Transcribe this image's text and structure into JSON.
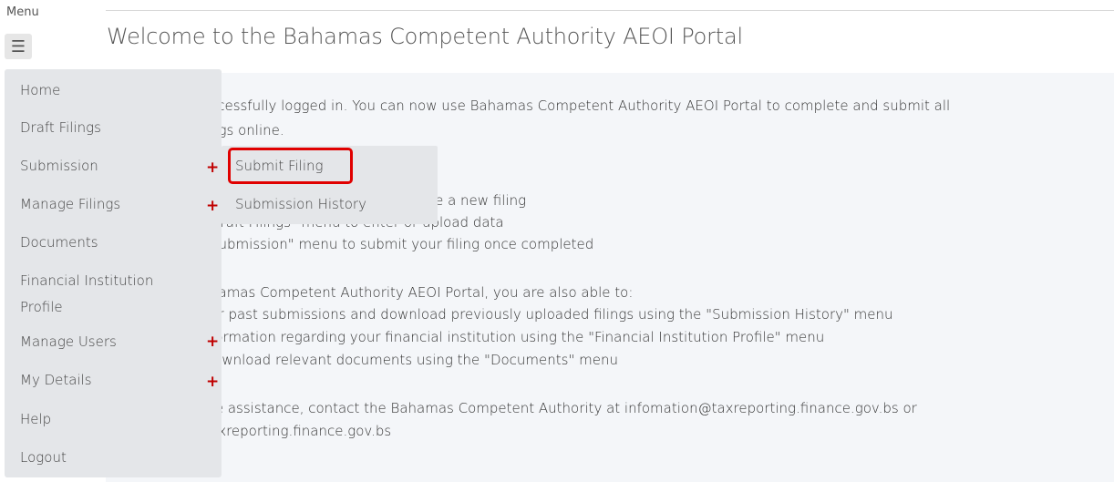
{
  "header": {
    "menu_label": "Menu",
    "title": "Welcome to the Bahamas Competent Authority AEOI Portal"
  },
  "menu": {
    "items": [
      {
        "label": "Home"
      },
      {
        "label": "Draft Filings"
      },
      {
        "label": "Submission",
        "has_submenu": true
      },
      {
        "label": "Manage Filings",
        "has_submenu": true
      },
      {
        "label": "Documents"
      },
      {
        "label": "Financial Institution",
        "label_line2": "Profile"
      },
      {
        "label": "Manage Users",
        "has_submenu": true
      },
      {
        "label": "My Details",
        "has_submenu": true
      },
      {
        "label": "Help"
      },
      {
        "label": "Logout"
      }
    ],
    "submission_submenu": [
      {
        "label": "Submit Filing",
        "highlighted": true
      },
      {
        "label": "Submission History"
      }
    ]
  },
  "content": {
    "lines": [
      "ccessfully logged in. You can now use Bahamas Competent Authority AEOI Portal to complete and submit all",
      "ngs online.",
      ":",
      "ate a new filing",
      "Draft Filings\" menu to enter or upload data",
      "Submission\" menu to submit your filing once completed",
      "hamas Competent Authority AEOI Portal, you are also able to:",
      "ur past submissions and download previously uploaded filings using the \"Submission History\" menu",
      "formation regarding your financial institution using the \"Financial Institution Profile\" menu",
      "lownload relevant documents using the \"Documents\" menu",
      "re assistance, contact the Bahamas Competent Authority at infomation@taxreporting.finance.gov.bs or",
      "axreporting.finance.gov.bs"
    ]
  },
  "colors": {
    "accent_red": "#e00000",
    "plus_red": "#c00000",
    "menu_bg": "#e4e6e9",
    "panel_bg": "#f4f6f9"
  },
  "icons": {
    "menu_toggle": "hamburger-icon",
    "expand": "plus-icon"
  }
}
